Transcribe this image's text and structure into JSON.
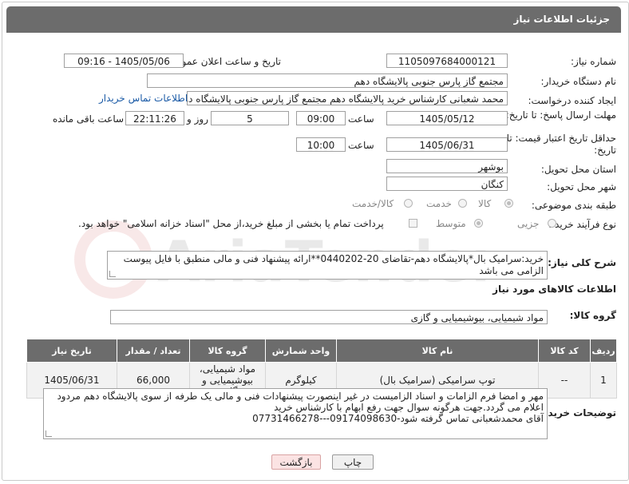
{
  "header": {
    "title": "جزئیات اطلاعات نیاز"
  },
  "fields": {
    "need_number_label": "شماره نیاز:",
    "need_number": "1105097684000121",
    "announce_label": "تاریخ و ساعت اعلان عمومی:",
    "announce_value": "1405/05/06 - 09:16",
    "buyer_org_label": "نام دستگاه خریدار:",
    "buyer_org": "مجتمع گاز پارس جنوبی  پالایشگاه دهم",
    "creator_label": "ایجاد کننده درخواست:",
    "creator": "محمد شعبانی کارشناس خرید پالایشگاه دهم  مجتمع گاز پارس جنوبی  پالایشگاه دهم",
    "buyer_contact_link": "اطلاعات تماس خریدار",
    "deadline_label": "مهلت ارسال پاسخ: تا تاریخ:",
    "deadline_date": "1405/05/12",
    "time_label": "ساعت",
    "deadline_time": "09:00",
    "days_value": "5",
    "days_label": "روز و",
    "remaining_time": "22:11:26",
    "remaining_label": "ساعت باقی مانده",
    "validity_label": "حداقل تاریخ اعتبار قیمت: تا تاریخ:",
    "validity_date": "1405/06/31",
    "validity_time": "10:00",
    "province_label": "استان محل تحویل:",
    "province": "بوشهر",
    "city_label": "شهر محل تحویل:",
    "city": "کنگان",
    "category_label": "طبقه بندی موضوعی:",
    "category_options": [
      "کالا",
      "خدمت",
      "کالا/خدمت"
    ],
    "process_label": "نوع فرآیند خرید :",
    "process_options": [
      "جزیی",
      "متوسط"
    ],
    "payment_note": "پرداخت تمام یا بخشی از مبلغ خرید،از محل \"اسناد خزانه اسلامی\" خواهد بود."
  },
  "summary": {
    "label": "شرح کلی نیاز:",
    "text": "خرید:سرامیک بال*پالایشگاه دهم-تقاضای 20-0440202**ارائه پیشنهاد فنی و مالی منطبق با فایل پیوست الزامی می باشد"
  },
  "goods_info_title": "اطلاعات کالاهای مورد نیاز",
  "goods_group": {
    "label": "گروه کالا:",
    "value": "مواد شیمیایی، بیوشیمیایی و  گازی"
  },
  "table": {
    "headers": [
      "ردیف",
      "کد کالا",
      "نام کالا",
      "واحد شمارش",
      "گروه کالا",
      "تعداد / مقدار",
      "تاریخ نیاز"
    ],
    "rows": [
      [
        "1",
        "--",
        "توپ سرامیکی (سرامیک بال)",
        "کیلوگرم",
        "مواد شیمیایی، بیوشیمیایی و گازی",
        "66,000",
        "1405/06/31"
      ]
    ]
  },
  "buyer_notes": {
    "label": "توضیحات خریدار:",
    "lines": [
      "مهر و امضا فرم الزامات و اسناد الزامیست در غیر اینصورت پیشنهادات فنی و مالی یک طرفه از سوی پالایشگاه دهم مردود",
      "اعلام می گردد.جهت هرگونه سوال جهت رفع ابهام با کارشناس خرید",
      "آقای محمدشعبانی تماس گرفته شود-09174098630---07731466278"
    ]
  },
  "buttons": {
    "print": "چاپ",
    "back": "بازگشت"
  },
  "watermark": "AriaTender.net"
}
